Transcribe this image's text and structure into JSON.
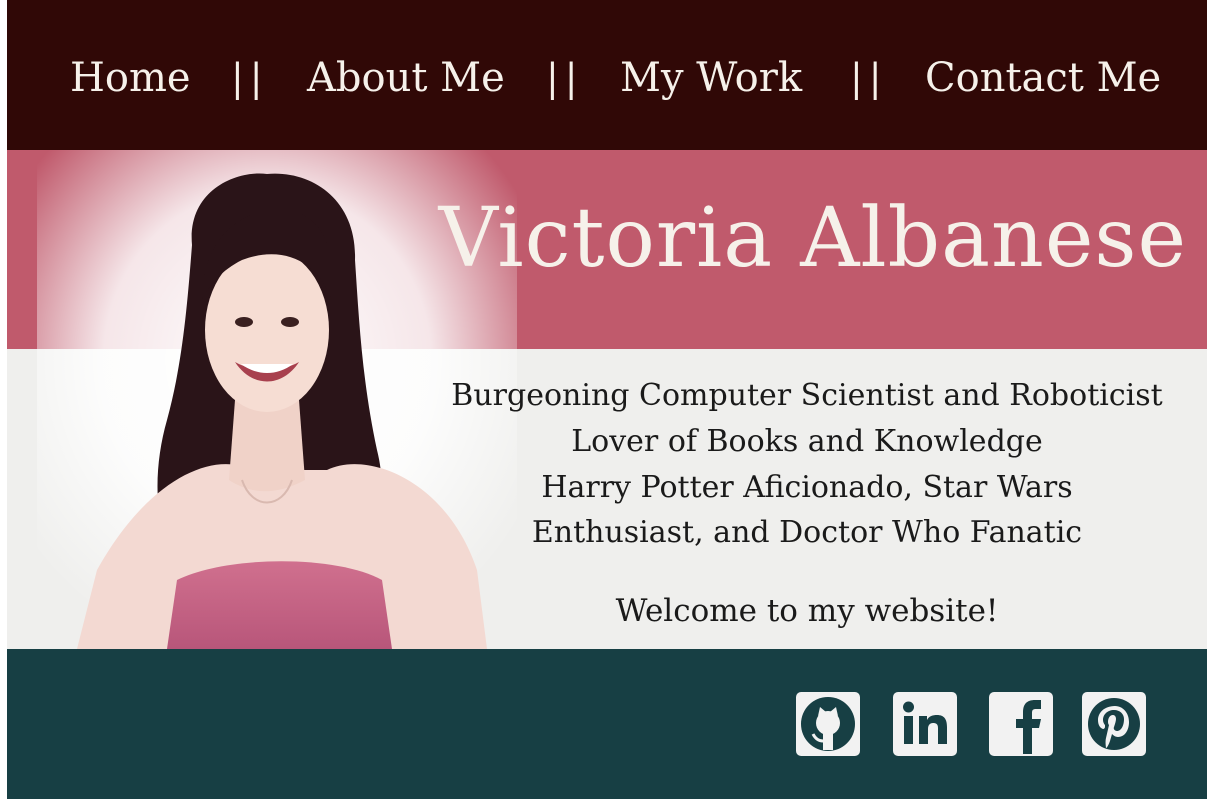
{
  "nav": {
    "items": [
      {
        "label": "Home"
      },
      {
        "label": "About Me"
      },
      {
        "label": "My Work"
      },
      {
        "label": "Contact Me"
      }
    ],
    "separator": "||"
  },
  "hero": {
    "name": "Victoria Albanese",
    "taglines": [
      "Burgeoning Computer Scientist and Roboticist",
      "Lover of Books and Knowledge",
      "Harry Potter Aficionado, Star Wars",
      "Enthusiast, and Doctor Who Fanatic"
    ],
    "welcome": "Welcome to my website!"
  },
  "social": {
    "icons": [
      "github-icon",
      "linkedin-icon",
      "facebook-icon",
      "pinterest-icon"
    ]
  },
  "colors": {
    "nav_bg": "#300806",
    "hero_pink": "#c05a6c",
    "hero_light": "#efefed",
    "footer_bg": "#173f44",
    "text_light": "#f6f1ea"
  }
}
